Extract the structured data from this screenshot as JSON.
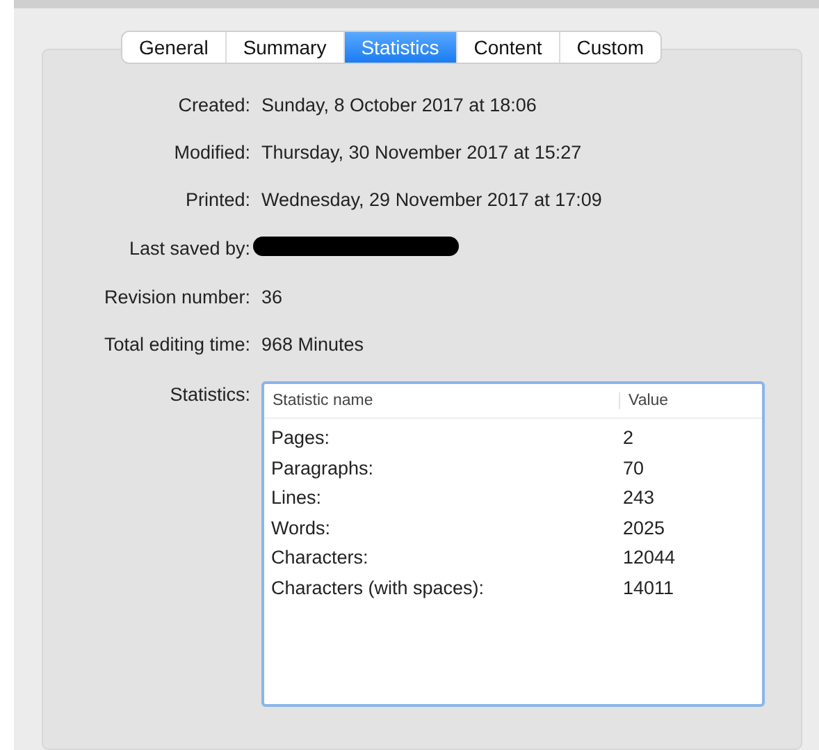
{
  "tabs": [
    {
      "label": "General",
      "selected": false
    },
    {
      "label": "Summary",
      "selected": false
    },
    {
      "label": "Statistics",
      "selected": true
    },
    {
      "label": "Content",
      "selected": false
    },
    {
      "label": "Custom",
      "selected": false
    }
  ],
  "fields": [
    {
      "label": "Created:",
      "value": "Sunday, 8 October 2017 at 18:06"
    },
    {
      "label": "Modified:",
      "value": "Thursday, 30 November 2017 at 15:27"
    },
    {
      "label": "Printed:",
      "value": "Wednesday, 29 November 2017 at 17:09"
    },
    {
      "label": "Last saved by:",
      "redacted": true
    },
    {
      "label": "Revision number:",
      "value": "36"
    },
    {
      "label": "Total editing time:",
      "value": "968 Minutes"
    }
  ],
  "statistics": {
    "label": "Statistics:",
    "columns": [
      "Statistic name",
      "Value"
    ],
    "rows": [
      {
        "name": "Pages:",
        "value": "2"
      },
      {
        "name": "Paragraphs:",
        "value": "70"
      },
      {
        "name": "Lines:",
        "value": "243"
      },
      {
        "name": "Words:",
        "value": "2025"
      },
      {
        "name": "Characters:",
        "value": "12044"
      },
      {
        "name": "Characters (with spaces):",
        "value": "14011"
      }
    ]
  }
}
